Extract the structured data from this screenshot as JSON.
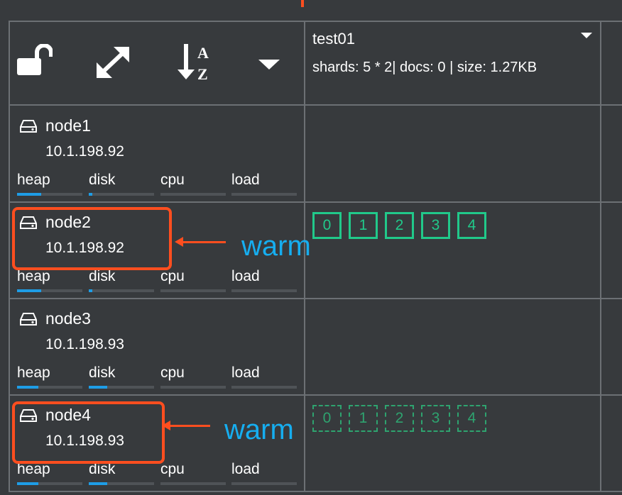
{
  "toolbar": {
    "icons": [
      "unlock-icon",
      "expand-icon",
      "sort-az-icon",
      "caret-down-icon"
    ],
    "sort_letter_a": "A",
    "sort_letter_z": "Z"
  },
  "index": {
    "name": "test01",
    "stats": "shards: 5 * 2| docs: 0 | size: 1.27KB"
  },
  "metric_labels": {
    "heap": "heap",
    "disk": "disk",
    "cpu": "cpu",
    "load": "load"
  },
  "nodes": [
    {
      "name": "node1",
      "ip": "10.1.198.92",
      "usage": {
        "heap": 0.37,
        "disk": 0.05,
        "cpu": 0.0,
        "load": 0.0
      }
    },
    {
      "name": "node2",
      "ip": "10.1.198.92",
      "usage": {
        "heap": 0.37,
        "disk": 0.05,
        "cpu": 0.0,
        "load": 0.0
      }
    },
    {
      "name": "node3",
      "ip": "10.1.198.93",
      "usage": {
        "heap": 0.33,
        "disk": 0.28,
        "cpu": 0.0,
        "load": 0.0
      }
    },
    {
      "name": "node4",
      "ip": "10.1.198.93",
      "usage": {
        "heap": 0.33,
        "disk": 0.28,
        "cpu": 0.0,
        "load": 0.0
      }
    }
  ],
  "primary_shards": [
    "0",
    "1",
    "2",
    "3",
    "4"
  ],
  "replica_shards": [
    "0",
    "1",
    "2",
    "3",
    "4"
  ],
  "annotations": {
    "node2_note": "warm",
    "node4_note": "warm"
  },
  "colors": {
    "primary": "#21c98a",
    "replica": "#2ea36f",
    "highlight": "#ff4e1f",
    "note": "#16aef0",
    "bar": "#1e9de6"
  }
}
